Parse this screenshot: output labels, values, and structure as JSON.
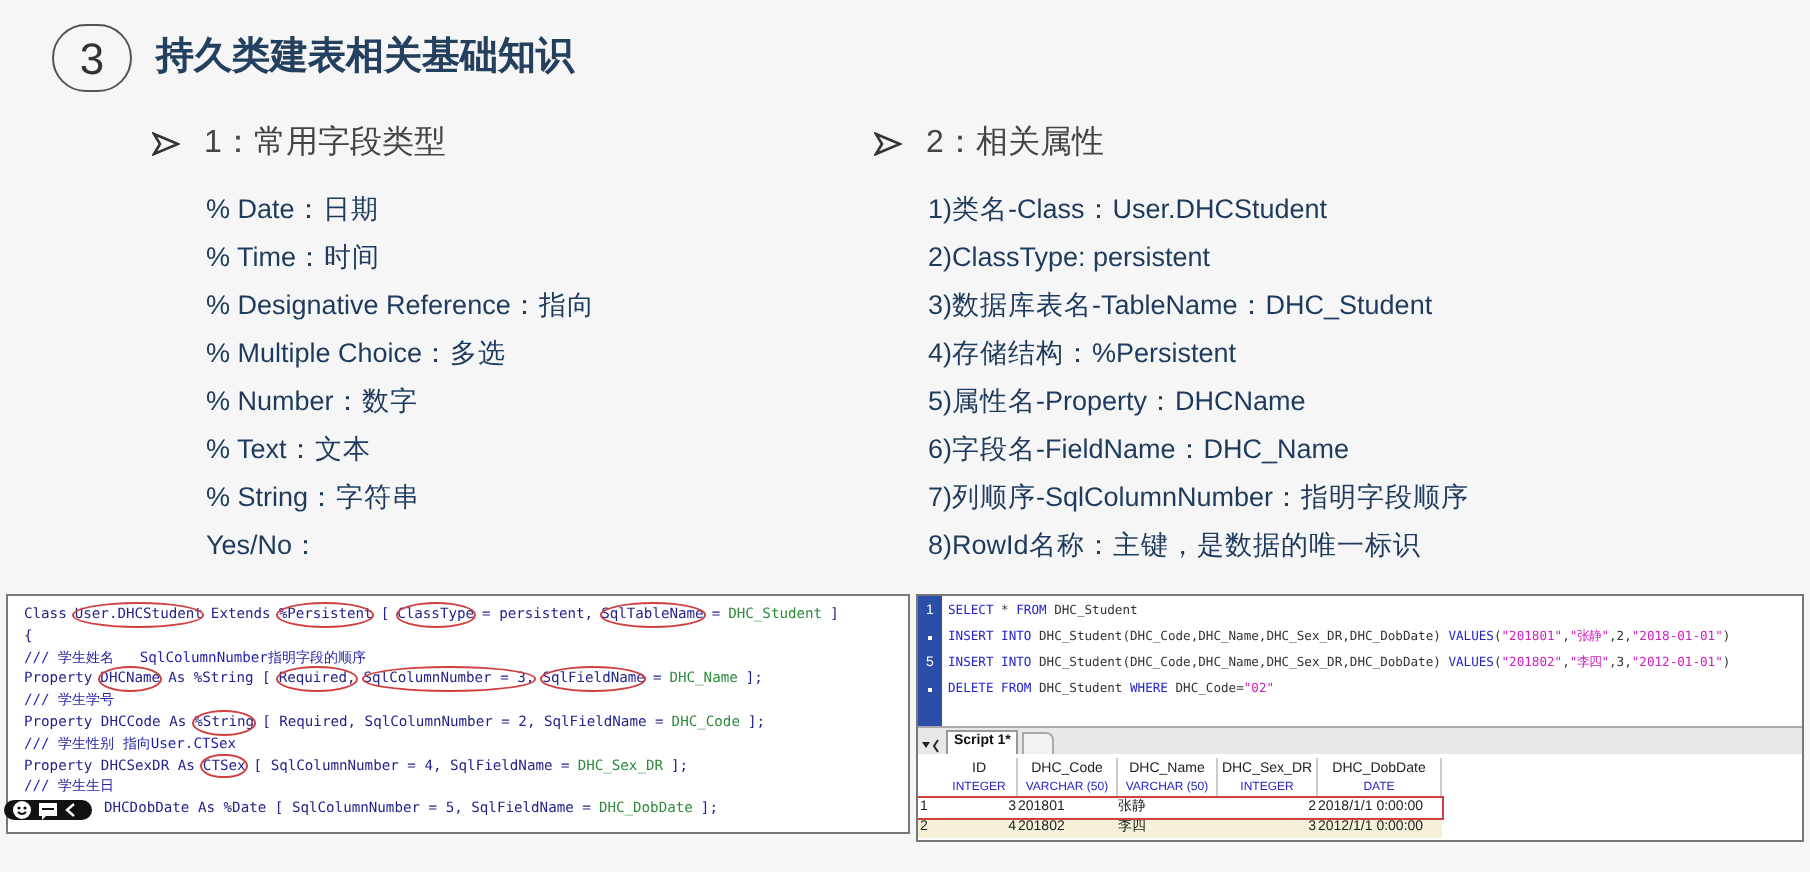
{
  "slide": {
    "number": "3",
    "title": "持久类建表相关基础知识"
  },
  "sections": [
    {
      "heading": "1：常用字段类型",
      "items": [
        "% Date：日期",
        "% Time：时间",
        "% Designative Reference：指向",
        "% Multiple Choice：多选",
        "% Number：数字",
        "% Text：文本",
        "% String：字符串",
        "Yes/No："
      ]
    },
    {
      "heading": "2：相关属性",
      "items": [
        "1)类名-Class：User.DHCStudent",
        "2)ClassType: persistent",
        "3)数据库表名-TableName：DHC_Student",
        "4)存储结构：%Persistent",
        "5)属性名-Property：DHCName",
        "6)字段名-FieldName：DHC_Name",
        "7)列顺序-SqlColumnNumber：指明字段顺序",
        "8)RowId名称：主键，是数据的唯一标识"
      ]
    }
  ],
  "class_code": [
    {
      "tokens": [
        {
          "text": "Class",
          "kind": "code"
        },
        {
          "text": "User.DHCStudent",
          "kind": "circled"
        },
        {
          "text": "Extends",
          "kind": "code"
        },
        {
          "text": "%Persistent",
          "kind": "circled"
        },
        {
          "text": "[",
          "kind": "code"
        },
        {
          "text": "ClassType",
          "kind": "circled"
        },
        {
          "text": "= persistent,",
          "kind": "code"
        },
        {
          "text": "SqlTableName",
          "kind": "circled"
        },
        {
          "text": "=",
          "kind": "code"
        },
        {
          "text": "DHC_Student",
          "kind": "value"
        },
        {
          "text": "]",
          "kind": "code"
        }
      ]
    },
    {
      "tokens": [
        {
          "text": "{",
          "kind": "code"
        }
      ]
    },
    {
      "tokens": [
        {
          "text": "/// 学生姓名   SqlColumnNumber指明字段的顺序",
          "kind": "comment"
        }
      ]
    },
    {
      "tokens": [
        {
          "text": "Property",
          "kind": "code"
        },
        {
          "text": "DHCName",
          "kind": "circled"
        },
        {
          "text": "As %String [",
          "kind": "code"
        },
        {
          "text": "Required,",
          "kind": "circled"
        },
        {
          "text": "SqlColumnNumber = 3,",
          "kind": "circled"
        },
        {
          "text": "SqlFieldName",
          "kind": "circled"
        },
        {
          "text": "=",
          "kind": "code"
        },
        {
          "text": "DHC_Name",
          "kind": "value"
        },
        {
          "text": "];",
          "kind": "code"
        }
      ]
    },
    {
      "tokens": [
        {
          "text": "/// 学生学号",
          "kind": "comment"
        }
      ]
    },
    {
      "tokens": [
        {
          "text": "Property DHCCode As",
          "kind": "code"
        },
        {
          "text": "%String",
          "kind": "circled"
        },
        {
          "text": "[ Required, SqlColumnNumber = 2, SqlFieldName =",
          "kind": "code"
        },
        {
          "text": "DHC_Code",
          "kind": "value"
        },
        {
          "text": "];",
          "kind": "code"
        }
      ]
    },
    {
      "tokens": [
        {
          "text": "/// 学生性别 指向User.CTSex",
          "kind": "comment"
        }
      ]
    },
    {
      "tokens": [
        {
          "text": "Property DHCSexDR As",
          "kind": "code"
        },
        {
          "text": "CTSex",
          "kind": "circled"
        },
        {
          "text": "[ SqlColumnNumber = 4, SqlFieldName =",
          "kind": "code"
        },
        {
          "text": "DHC_Sex_DR",
          "kind": "value"
        },
        {
          "text": "];",
          "kind": "code"
        }
      ]
    },
    {
      "tokens": [
        {
          "text": "/// 学生生日",
          "kind": "comment"
        }
      ]
    },
    {
      "tokens": [
        {
          "text": "DHCDobDate As %Date [ SqlColumnNumber = 5, SqlFieldName =",
          "kind": "code"
        },
        {
          "text": "DHC_DobDate",
          "kind": "value"
        },
        {
          "text": "];",
          "kind": "code"
        }
      ]
    }
  ],
  "sql_editor": {
    "lines": [
      {
        "gutter": "1",
        "tokens": [
          {
            "text": "SELECT",
            "kind": "keyword"
          },
          {
            "text": " * ",
            "kind": "plain"
          },
          {
            "text": "FROM",
            "kind": "keyword"
          },
          {
            "text": " DHC_Student",
            "kind": "plain"
          }
        ]
      },
      {
        "tokens": [
          {
            "text": "INSERT INTO",
            "kind": "keyword"
          },
          {
            "text": " DHC_Student(DHC_Code,DHC_Name,DHC_Sex_DR,DHC_DobDate) ",
            "kind": "plain"
          },
          {
            "text": "VALUES",
            "kind": "keyword"
          },
          {
            "text": "(",
            "kind": "plain"
          },
          {
            "text": "\"201801\"",
            "kind": "string"
          },
          {
            "text": ",",
            "kind": "plain"
          },
          {
            "text": "\"张静\"",
            "kind": "string"
          },
          {
            "text": ",2,",
            "kind": "plain"
          },
          {
            "text": "\"2018-01-01\"",
            "kind": "string"
          },
          {
            "text": ")",
            "kind": "plain"
          }
        ]
      },
      {
        "gutter": "5",
        "tokens": [
          {
            "text": "INSERT INTO",
            "kind": "keyword"
          },
          {
            "text": " DHC_Student(DHC_Code,DHC_Name,DHC_Sex_DR,DHC_DobDate) ",
            "kind": "plain"
          },
          {
            "text": "VALUES",
            "kind": "keyword"
          },
          {
            "text": "(",
            "kind": "plain"
          },
          {
            "text": "\"201802\"",
            "kind": "string"
          },
          {
            "text": ",",
            "kind": "plain"
          },
          {
            "text": "\"李四\"",
            "kind": "string"
          },
          {
            "text": ",3,",
            "kind": "plain"
          },
          {
            "text": "\"2012-01-01\"",
            "kind": "string"
          },
          {
            "text": ")",
            "kind": "plain"
          }
        ]
      },
      {
        "tokens": [
          {
            "text": "DELETE FROM",
            "kind": "keyword"
          },
          {
            "text": " DHC_Student ",
            "kind": "plain"
          },
          {
            "text": "WHERE",
            "kind": "keyword"
          },
          {
            "text": " DHC_Code=",
            "kind": "plain"
          },
          {
            "text": "\"02\"",
            "kind": "string"
          }
        ]
      }
    ],
    "tabs": [
      {
        "label": "Script 1*",
        "selected": true
      }
    ],
    "results": {
      "columns": [
        {
          "name": "ID",
          "type": "INTEGER"
        },
        {
          "name": "DHC_Code",
          "type": "VARCHAR (50)"
        },
        {
          "name": "DHC_Name",
          "type": "VARCHAR (50)"
        },
        {
          "name": "DHC_Sex_DR",
          "type": "INTEGER"
        },
        {
          "name": "DHC_DobDate",
          "type": "DATE"
        }
      ],
      "rows": [
        {
          "number": "1",
          "selected": true,
          "cells": [
            "3",
            "201801",
            "张静",
            "2",
            "2018/1/1 0:00:00"
          ]
        },
        {
          "number": "2",
          "selected": false,
          "cells": [
            "4",
            "201802",
            "李四",
            "3",
            "2012/1/1 0:00:00"
          ]
        }
      ]
    }
  }
}
